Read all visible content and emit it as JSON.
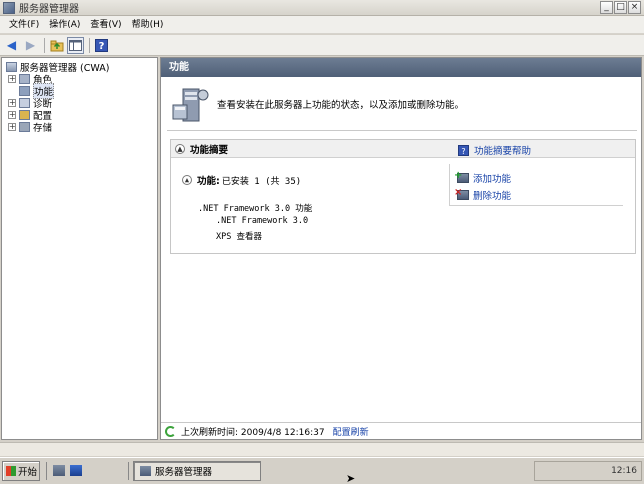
{
  "window": {
    "title": "服务器管理器",
    "controls": [
      "_",
      "□",
      "×"
    ]
  },
  "menu": [
    "文件(F)",
    "操作(A)",
    "查看(V)",
    "帮助(H)"
  ],
  "tree": {
    "root": "服务器管理器 (CWA)",
    "items": [
      {
        "label": "角色",
        "expander": "+"
      },
      {
        "label": "功能",
        "expander": ""
      },
      {
        "label": "诊断",
        "expander": "+"
      },
      {
        "label": "配置",
        "expander": "+"
      },
      {
        "label": "存储",
        "expander": "+"
      }
    ]
  },
  "content": {
    "header": "功能",
    "intro": "查看安装在此服务器上功能的状态，以及添加或删除功能。",
    "summary": {
      "title": "功能摘要",
      "help_link": "功能摘要帮助",
      "installed_label": "功能:",
      "installed_value": "已安装 1 (共 35)",
      "features": [
        ".NET Framework 3.0 功能",
        ".NET Framework 3.0",
        "XPS 查看器"
      ],
      "actions": [
        "添加功能",
        "删除功能"
      ]
    },
    "refresh": {
      "text": "上次刷新时间: 2009/4/8 12:16:37",
      "link": "配置刷新"
    }
  },
  "taskbar": {
    "start": "开始",
    "task": "服务器管理器",
    "clock": "12:16"
  }
}
